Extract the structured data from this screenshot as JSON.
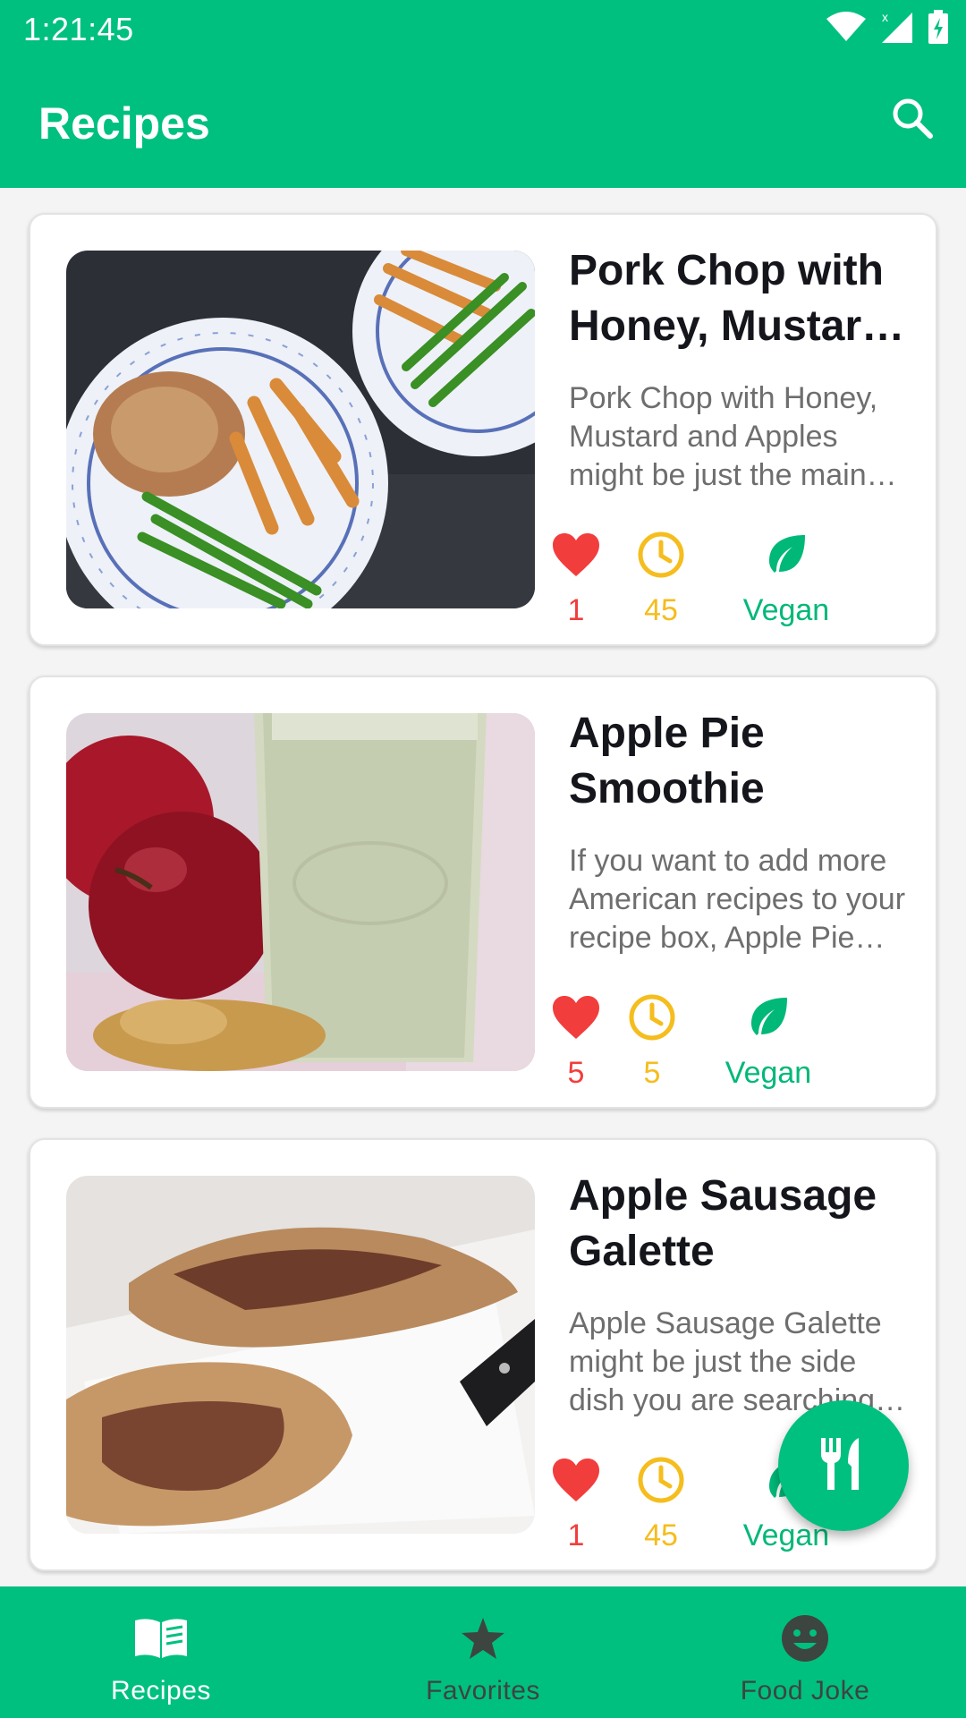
{
  "status_bar": {
    "time": "1:21:45",
    "icons": [
      "wifi-icon",
      "signal-icon",
      "battery-charging-icon"
    ]
  },
  "app_bar": {
    "title": "Recipes",
    "action_icon": "search-icon"
  },
  "recipes": [
    {
      "title": "Pork Chop with Honey, Mustard and Apples",
      "description": "Pork Chop with Honey, Mustard and Apples might be just the main course you are searching for.",
      "likes": "1",
      "minutes": "45",
      "vegan_label": "Vegan"
    },
    {
      "title": "Apple Pie Smoothie",
      "description": "If you want to add more American recipes to your recipe box, Apple Pie Smoothie might be a recipe you should try.",
      "likes": "5",
      "minutes": "5",
      "vegan_label": "Vegan"
    },
    {
      "title": "Apple Sausage Galette",
      "description": "Apple Sausage Galette might be just the side dish you are searching for.",
      "likes": "1",
      "minutes": "45",
      "vegan_label": "Vegan"
    }
  ],
  "fab": {
    "icon": "fork-knife-icon"
  },
  "bottom_nav": {
    "items": [
      {
        "label": "Recipes",
        "icon": "book-icon",
        "active": true
      },
      {
        "label": "Favorites",
        "icon": "star-icon",
        "active": false
      },
      {
        "label": "Food Joke",
        "icon": "smiley-icon",
        "active": false
      }
    ]
  },
  "colors": {
    "primary": "#00c07f",
    "likes": "#f23d3d",
    "time": "#f5bd1d",
    "vegan": "#00b878"
  }
}
